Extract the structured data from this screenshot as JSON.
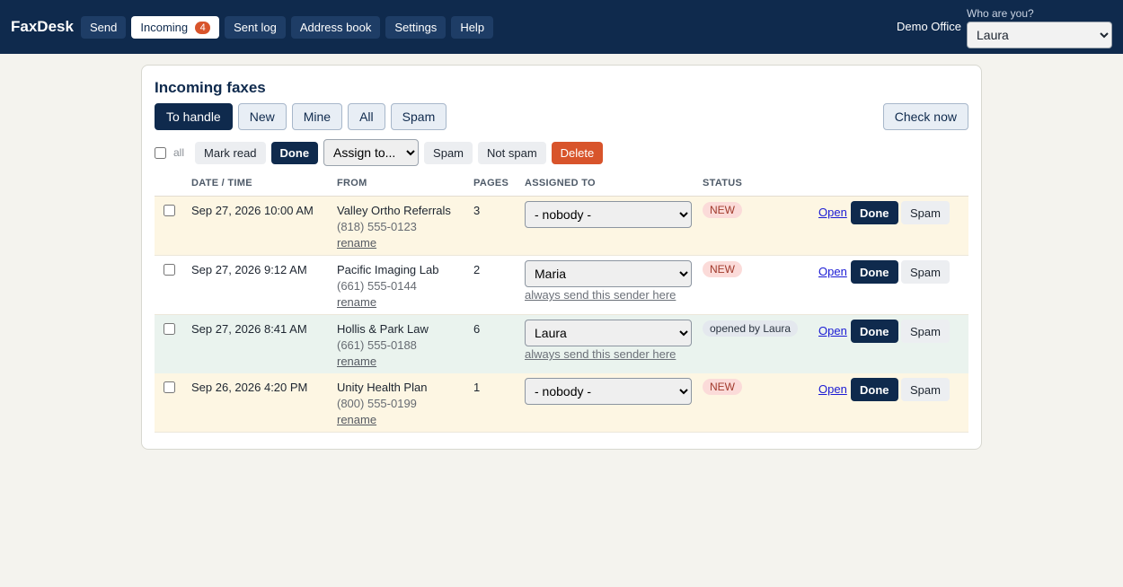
{
  "app": {
    "brand": "FaxDesk",
    "office": "Demo Office"
  },
  "nav": {
    "send": "Send",
    "incoming": "Incoming",
    "incoming_count": "4",
    "sent_log": "Sent log",
    "address_book": "Address book",
    "settings": "Settings",
    "help": "Help"
  },
  "user": {
    "label": "Who are you?",
    "selected": "Laura"
  },
  "page": {
    "title": "Incoming faxes"
  },
  "filters": {
    "to_handle": "To handle",
    "new": "New",
    "mine": "Mine",
    "all": "All",
    "spam": "Spam",
    "check_now": "Check now"
  },
  "bulk": {
    "all_label": "all",
    "mark_read": "Mark read",
    "done": "Done",
    "assign": "Assign to...",
    "spam": "Spam",
    "not_spam": "Not spam",
    "delete": "Delete"
  },
  "table": {
    "headers": {
      "date": "DATE / TIME",
      "from": "FROM",
      "pages": "PAGES",
      "assigned": "ASSIGNED TO",
      "status": "STATUS"
    },
    "rows": [
      {
        "date": "Sep 27, 2026 10:00 AM",
        "from": "Valley Ortho Referrals",
        "phone": "(818) 555-0123",
        "rename": "rename",
        "pages": "3",
        "assigned": "- nobody -",
        "always": "",
        "status": "NEW",
        "open": "Open",
        "done": "Done",
        "spam": "Spam"
      },
      {
        "date": "Sep 27, 2026 9:12 AM",
        "from": "Pacific Imaging Lab",
        "phone": "(661) 555-0144",
        "rename": "rename",
        "pages": "2",
        "assigned": "Maria",
        "always": "always send this sender here",
        "status": "NEW",
        "open": "Open",
        "done": "Done",
        "spam": "Spam"
      },
      {
        "date": "Sep 27, 2026 8:41 AM",
        "from": "Hollis & Park Law",
        "phone": "(661) 555-0188",
        "rename": "rename",
        "pages": "6",
        "assigned": "Laura",
        "always": "always send this sender here",
        "status": "opened by Laura",
        "open": "Open",
        "done": "Done",
        "spam": "Spam"
      },
      {
        "date": "Sep 26, 2026 4:20 PM",
        "from": "Unity Health Plan",
        "phone": "(800) 555-0199",
        "rename": "rename",
        "pages": "1",
        "assigned": "- nobody -",
        "always": "",
        "status": "NEW",
        "open": "Open",
        "done": "Done",
        "spam": "Spam"
      }
    ]
  }
}
